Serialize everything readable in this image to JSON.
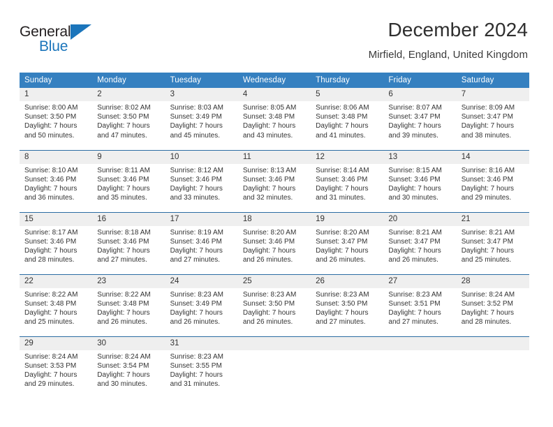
{
  "brand": {
    "name_part1": "General",
    "name_part2": "Blue",
    "flag_icon": "blue-triangle-flag-icon",
    "accent_color": "#1b75bb"
  },
  "header": {
    "title": "December 2024",
    "location": "Mirfield, England, United Kingdom"
  },
  "theme": {
    "header_row_bg": "#3580c0",
    "day_number_bg": "#efefef",
    "row_divider": "#2b6ca3",
    "text_color": "#333333"
  },
  "weekday_headers": [
    "Sunday",
    "Monday",
    "Tuesday",
    "Wednesday",
    "Thursday",
    "Friday",
    "Saturday"
  ],
  "weeks": [
    [
      {
        "day": "1",
        "sunrise": "Sunrise: 8:00 AM",
        "sunset": "Sunset: 3:50 PM",
        "daylight_line1": "Daylight: 7 hours",
        "daylight_line2": "and 50 minutes."
      },
      {
        "day": "2",
        "sunrise": "Sunrise: 8:02 AM",
        "sunset": "Sunset: 3:50 PM",
        "daylight_line1": "Daylight: 7 hours",
        "daylight_line2": "and 47 minutes."
      },
      {
        "day": "3",
        "sunrise": "Sunrise: 8:03 AM",
        "sunset": "Sunset: 3:49 PM",
        "daylight_line1": "Daylight: 7 hours",
        "daylight_line2": "and 45 minutes."
      },
      {
        "day": "4",
        "sunrise": "Sunrise: 8:05 AM",
        "sunset": "Sunset: 3:48 PM",
        "daylight_line1": "Daylight: 7 hours",
        "daylight_line2": "and 43 minutes."
      },
      {
        "day": "5",
        "sunrise": "Sunrise: 8:06 AM",
        "sunset": "Sunset: 3:48 PM",
        "daylight_line1": "Daylight: 7 hours",
        "daylight_line2": "and 41 minutes."
      },
      {
        "day": "6",
        "sunrise": "Sunrise: 8:07 AM",
        "sunset": "Sunset: 3:47 PM",
        "daylight_line1": "Daylight: 7 hours",
        "daylight_line2": "and 39 minutes."
      },
      {
        "day": "7",
        "sunrise": "Sunrise: 8:09 AM",
        "sunset": "Sunset: 3:47 PM",
        "daylight_line1": "Daylight: 7 hours",
        "daylight_line2": "and 38 minutes."
      }
    ],
    [
      {
        "day": "8",
        "sunrise": "Sunrise: 8:10 AM",
        "sunset": "Sunset: 3:46 PM",
        "daylight_line1": "Daylight: 7 hours",
        "daylight_line2": "and 36 minutes."
      },
      {
        "day": "9",
        "sunrise": "Sunrise: 8:11 AM",
        "sunset": "Sunset: 3:46 PM",
        "daylight_line1": "Daylight: 7 hours",
        "daylight_line2": "and 35 minutes."
      },
      {
        "day": "10",
        "sunrise": "Sunrise: 8:12 AM",
        "sunset": "Sunset: 3:46 PM",
        "daylight_line1": "Daylight: 7 hours",
        "daylight_line2": "and 33 minutes."
      },
      {
        "day": "11",
        "sunrise": "Sunrise: 8:13 AM",
        "sunset": "Sunset: 3:46 PM",
        "daylight_line1": "Daylight: 7 hours",
        "daylight_line2": "and 32 minutes."
      },
      {
        "day": "12",
        "sunrise": "Sunrise: 8:14 AM",
        "sunset": "Sunset: 3:46 PM",
        "daylight_line1": "Daylight: 7 hours",
        "daylight_line2": "and 31 minutes."
      },
      {
        "day": "13",
        "sunrise": "Sunrise: 8:15 AM",
        "sunset": "Sunset: 3:46 PM",
        "daylight_line1": "Daylight: 7 hours",
        "daylight_line2": "and 30 minutes."
      },
      {
        "day": "14",
        "sunrise": "Sunrise: 8:16 AM",
        "sunset": "Sunset: 3:46 PM",
        "daylight_line1": "Daylight: 7 hours",
        "daylight_line2": "and 29 minutes."
      }
    ],
    [
      {
        "day": "15",
        "sunrise": "Sunrise: 8:17 AM",
        "sunset": "Sunset: 3:46 PM",
        "daylight_line1": "Daylight: 7 hours",
        "daylight_line2": "and 28 minutes."
      },
      {
        "day": "16",
        "sunrise": "Sunrise: 8:18 AM",
        "sunset": "Sunset: 3:46 PM",
        "daylight_line1": "Daylight: 7 hours",
        "daylight_line2": "and 27 minutes."
      },
      {
        "day": "17",
        "sunrise": "Sunrise: 8:19 AM",
        "sunset": "Sunset: 3:46 PM",
        "daylight_line1": "Daylight: 7 hours",
        "daylight_line2": "and 27 minutes."
      },
      {
        "day": "18",
        "sunrise": "Sunrise: 8:20 AM",
        "sunset": "Sunset: 3:46 PM",
        "daylight_line1": "Daylight: 7 hours",
        "daylight_line2": "and 26 minutes."
      },
      {
        "day": "19",
        "sunrise": "Sunrise: 8:20 AM",
        "sunset": "Sunset: 3:47 PM",
        "daylight_line1": "Daylight: 7 hours",
        "daylight_line2": "and 26 minutes."
      },
      {
        "day": "20",
        "sunrise": "Sunrise: 8:21 AM",
        "sunset": "Sunset: 3:47 PM",
        "daylight_line1": "Daylight: 7 hours",
        "daylight_line2": "and 26 minutes."
      },
      {
        "day": "21",
        "sunrise": "Sunrise: 8:21 AM",
        "sunset": "Sunset: 3:47 PM",
        "daylight_line1": "Daylight: 7 hours",
        "daylight_line2": "and 25 minutes."
      }
    ],
    [
      {
        "day": "22",
        "sunrise": "Sunrise: 8:22 AM",
        "sunset": "Sunset: 3:48 PM",
        "daylight_line1": "Daylight: 7 hours",
        "daylight_line2": "and 25 minutes."
      },
      {
        "day": "23",
        "sunrise": "Sunrise: 8:22 AM",
        "sunset": "Sunset: 3:48 PM",
        "daylight_line1": "Daylight: 7 hours",
        "daylight_line2": "and 26 minutes."
      },
      {
        "day": "24",
        "sunrise": "Sunrise: 8:23 AM",
        "sunset": "Sunset: 3:49 PM",
        "daylight_line1": "Daylight: 7 hours",
        "daylight_line2": "and 26 minutes."
      },
      {
        "day": "25",
        "sunrise": "Sunrise: 8:23 AM",
        "sunset": "Sunset: 3:50 PM",
        "daylight_line1": "Daylight: 7 hours",
        "daylight_line2": "and 26 minutes."
      },
      {
        "day": "26",
        "sunrise": "Sunrise: 8:23 AM",
        "sunset": "Sunset: 3:50 PM",
        "daylight_line1": "Daylight: 7 hours",
        "daylight_line2": "and 27 minutes."
      },
      {
        "day": "27",
        "sunrise": "Sunrise: 8:23 AM",
        "sunset": "Sunset: 3:51 PM",
        "daylight_line1": "Daylight: 7 hours",
        "daylight_line2": "and 27 minutes."
      },
      {
        "day": "28",
        "sunrise": "Sunrise: 8:24 AM",
        "sunset": "Sunset: 3:52 PM",
        "daylight_line1": "Daylight: 7 hours",
        "daylight_line2": "and 28 minutes."
      }
    ],
    [
      {
        "day": "29",
        "sunrise": "Sunrise: 8:24 AM",
        "sunset": "Sunset: 3:53 PM",
        "daylight_line1": "Daylight: 7 hours",
        "daylight_line2": "and 29 minutes."
      },
      {
        "day": "30",
        "sunrise": "Sunrise: 8:24 AM",
        "sunset": "Sunset: 3:54 PM",
        "daylight_line1": "Daylight: 7 hours",
        "daylight_line2": "and 30 minutes."
      },
      {
        "day": "31",
        "sunrise": "Sunrise: 8:23 AM",
        "sunset": "Sunset: 3:55 PM",
        "daylight_line1": "Daylight: 7 hours",
        "daylight_line2": "and 31 minutes."
      },
      {
        "day": "",
        "sunrise": "",
        "sunset": "",
        "daylight_line1": "",
        "daylight_line2": ""
      },
      {
        "day": "",
        "sunrise": "",
        "sunset": "",
        "daylight_line1": "",
        "daylight_line2": ""
      },
      {
        "day": "",
        "sunrise": "",
        "sunset": "",
        "daylight_line1": "",
        "daylight_line2": ""
      },
      {
        "day": "",
        "sunrise": "",
        "sunset": "",
        "daylight_line1": "",
        "daylight_line2": ""
      }
    ]
  ]
}
